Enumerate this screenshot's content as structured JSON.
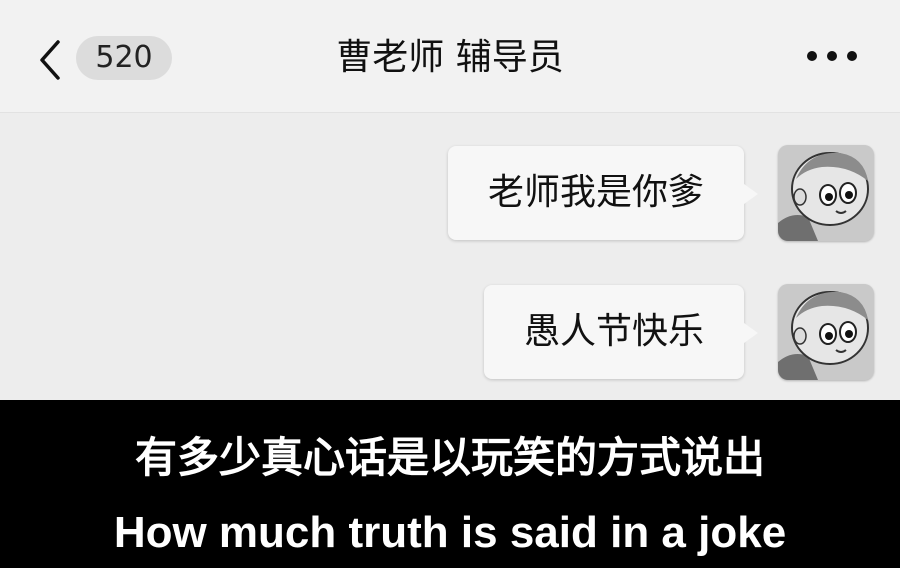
{
  "header": {
    "unread_count": "520",
    "title": "曹老师 辅导员",
    "back_icon": "chevron-left-icon",
    "more_icon": "ellipsis-icon"
  },
  "messages": [
    {
      "sender": "self",
      "text": "老师我是你爹"
    },
    {
      "sender": "self",
      "text": "愚人节快乐"
    }
  ],
  "caption": {
    "chinese": "有多少真心话是以玩笑的方式说出",
    "english": "How much truth is said in a joke"
  },
  "colors": {
    "chat_background": "#ededed",
    "bubble_background": "#f7f7f7",
    "caption_background": "#000000",
    "caption_text": "#ffffff"
  }
}
